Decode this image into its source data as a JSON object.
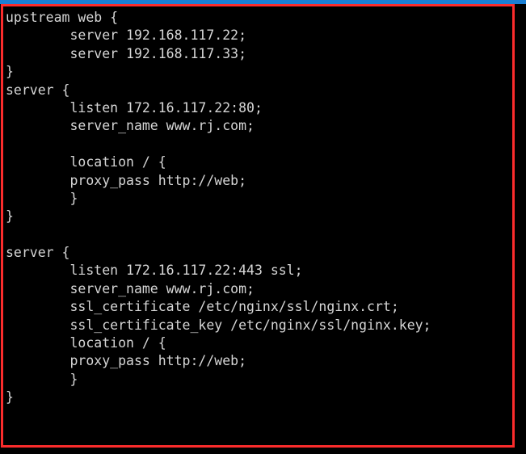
{
  "window": {
    "title_bar_color": "#1a7fd4",
    "background_color": "#000000",
    "text_color": "#d6d6d6"
  },
  "annotation": {
    "shape": "rectangle",
    "color": "#fb2c2c",
    "label": "nginx config highlight box"
  },
  "terminal": {
    "file_type": "nginx configuration",
    "lines": [
      "upstream web {",
      "        server 192.168.117.22;",
      "        server 192.168.117.33;",
      "}",
      "server {",
      "        listen 172.16.117.22:80;",
      "        server_name www.rj.com;",
      "",
      "        location / {",
      "        proxy_pass http://web;",
      "        }",
      "}",
      "",
      "server {",
      "        listen 172.16.117.22:443 ssl;",
      "        server_name www.rj.com;",
      "        ssl_certificate /etc/nginx/ssl/nginx.crt;",
      "        ssl_certificate_key /etc/nginx/ssl/nginx.key;",
      "        location / {",
      "        proxy_pass http://web;",
      "        }",
      "}"
    ]
  }
}
